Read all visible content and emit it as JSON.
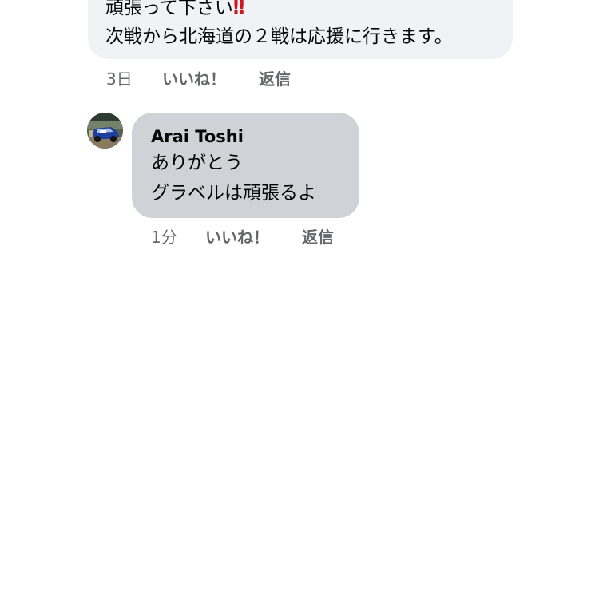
{
  "comments": [
    {
      "lines": [
        "頑張って下さい",
        "次戦から北海道の２戦は応援に行きます。"
      ],
      "emoji": "‼",
      "time": "3日",
      "like_label": "いいね！",
      "reply_label": "返信"
    },
    {
      "author": "Arai Toshi",
      "lines": [
        "ありがとう",
        "グラベルは頑張るよ"
      ],
      "time": "1分",
      "like_label": "いいね！",
      "reply_label": "返信"
    }
  ],
  "colors": {
    "bubble_first": "#f0f2f5",
    "bubble_second": "#cfd2d6",
    "meta_text": "#65676b",
    "emoji_red": "#d0131f"
  }
}
